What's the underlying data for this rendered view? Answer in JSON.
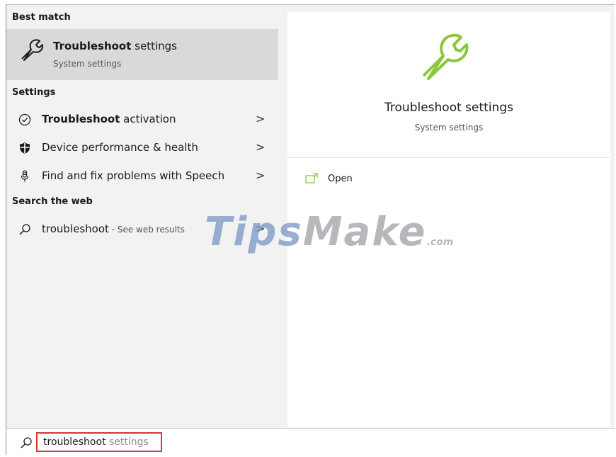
{
  "left_panel": {
    "best_match_header": "Best match",
    "best_match": {
      "title_bold": "Troubleshoot",
      "title_rest": " settings",
      "subtitle": "System settings",
      "icon": "wrench-icon"
    },
    "settings_header": "Settings",
    "settings_items": [
      {
        "bold": "Troubleshoot",
        "rest": " activation",
        "icon": "check-circle-icon",
        "chevron": ">"
      },
      {
        "bold": "",
        "rest": "Device performance & health",
        "icon": "shield-icon",
        "chevron": ">"
      },
      {
        "bold": "",
        "rest": "Find and fix problems with Speech",
        "icon": "microphone-icon",
        "chevron": ">"
      }
    ],
    "web_header": "Search the web",
    "web_result": {
      "query": "troubleshoot",
      "suffix": " - See web results",
      "icon": "search-icon",
      "chevron": ">"
    }
  },
  "right_panel": {
    "title": "Troubleshoot settings",
    "subtitle": "System settings",
    "hero_icon": "wrench-icon",
    "accent_color": "#8cc63f",
    "actions": [
      {
        "label": "Open",
        "icon": "open-window-icon"
      }
    ]
  },
  "search_bar": {
    "typed": "troubleshoot",
    "suggestion": " settings",
    "highlight_color": "#d9343a"
  },
  "watermark": {
    "part1": "Tips",
    "part2": "Make",
    "suffix": ".com"
  }
}
